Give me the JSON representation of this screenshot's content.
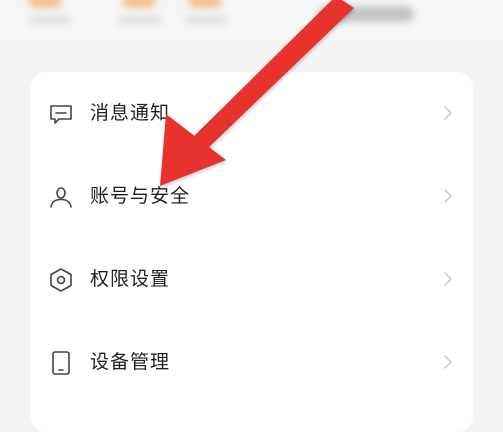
{
  "menu": {
    "items": [
      {
        "label": "消息通知",
        "icon": "message-icon"
      },
      {
        "label": "账号与安全",
        "icon": "user-icon"
      },
      {
        "label": "权限设置",
        "icon": "permission-hexagon-icon"
      },
      {
        "label": "设备管理",
        "icon": "device-icon"
      }
    ]
  },
  "colors": {
    "background": "#f4f4f5",
    "card": "#ffffff",
    "text": "#1f1f1f",
    "icon": "#444444",
    "chevron": "#c8c8c8",
    "annotation_arrow": "#e8312f"
  }
}
